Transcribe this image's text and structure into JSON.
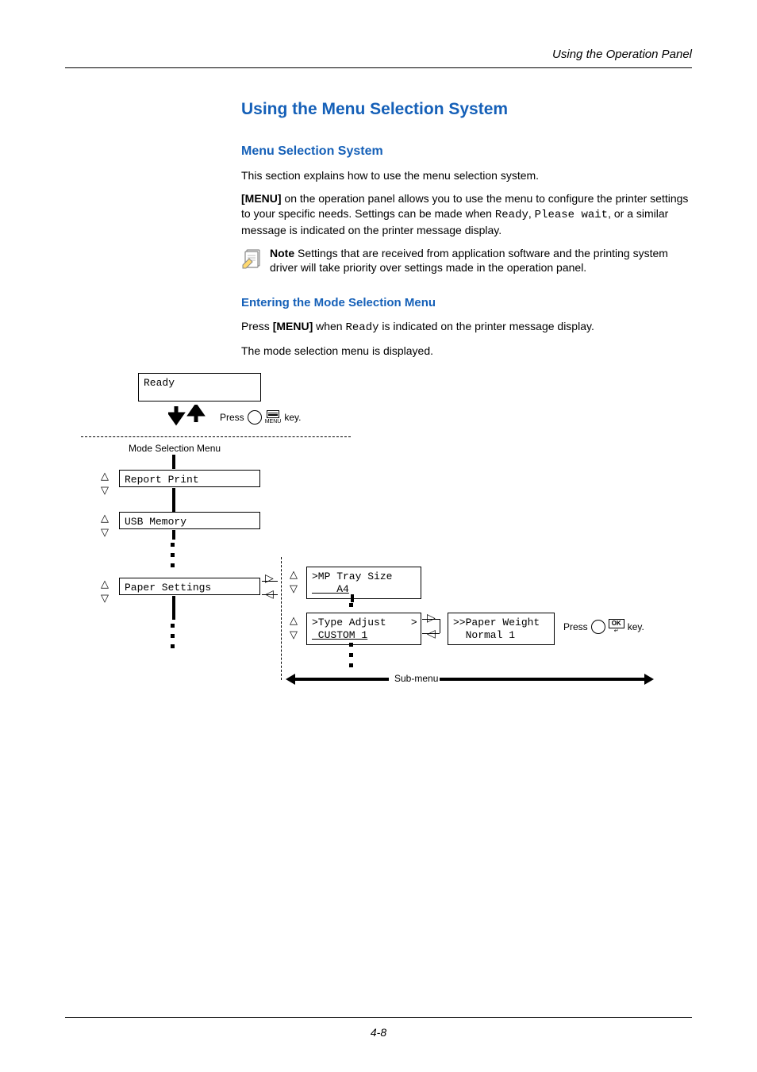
{
  "header": {
    "section_title": "Using the Operation Panel"
  },
  "main_heading": "Using the Menu Selection System",
  "sub_heading_1": "Menu Selection System",
  "para_1": "This section explains how to use the menu selection system.",
  "para_2_pre": "[MENU]",
  "para_2_body": " on the operation panel allows you to use the menu to configure the printer settings to your specific needs. Settings can be made when ",
  "para_2_mono1": "Ready",
  "para_2_mid": ", ",
  "para_2_mono2": "Please wait",
  "para_2_tail": ", or a similar message is indicated on the printer message display.",
  "note": {
    "label": "Note",
    "text": "  Settings that are received from application software and the printing system driver will take priority over settings made in the operation panel."
  },
  "sub_heading_2": "Entering the Mode Selection Menu",
  "para_3_pre": "Press ",
  "para_3_bold": "[MENU]",
  "para_3_mid": " when ",
  "para_3_mono": "Ready",
  "para_3_tail": " is indicated on the printer message display.",
  "para_4": "The mode selection menu is displayed.",
  "diagram": {
    "ready": "Ready",
    "press": "Press",
    "key": "key.",
    "menu_label": "MENU",
    "mode_selection": "Mode Selection Menu",
    "report_print": "Report Print",
    "usb_memory": "USB Memory",
    "paper_settings": "Paper Settings",
    "mp_tray_size_l1": ">MP Tray Size",
    "mp_tray_size_l2": "    A4",
    "type_adjust_l1": ">Type Adjust    >",
    "type_adjust_l2": " CUSTOM 1",
    "paper_weight_l1": ">>Paper Weight",
    "paper_weight_l2": "  Normal 1",
    "sub_menu": "Sub-menu",
    "ok_label": "OK"
  },
  "page_number": "4-8"
}
